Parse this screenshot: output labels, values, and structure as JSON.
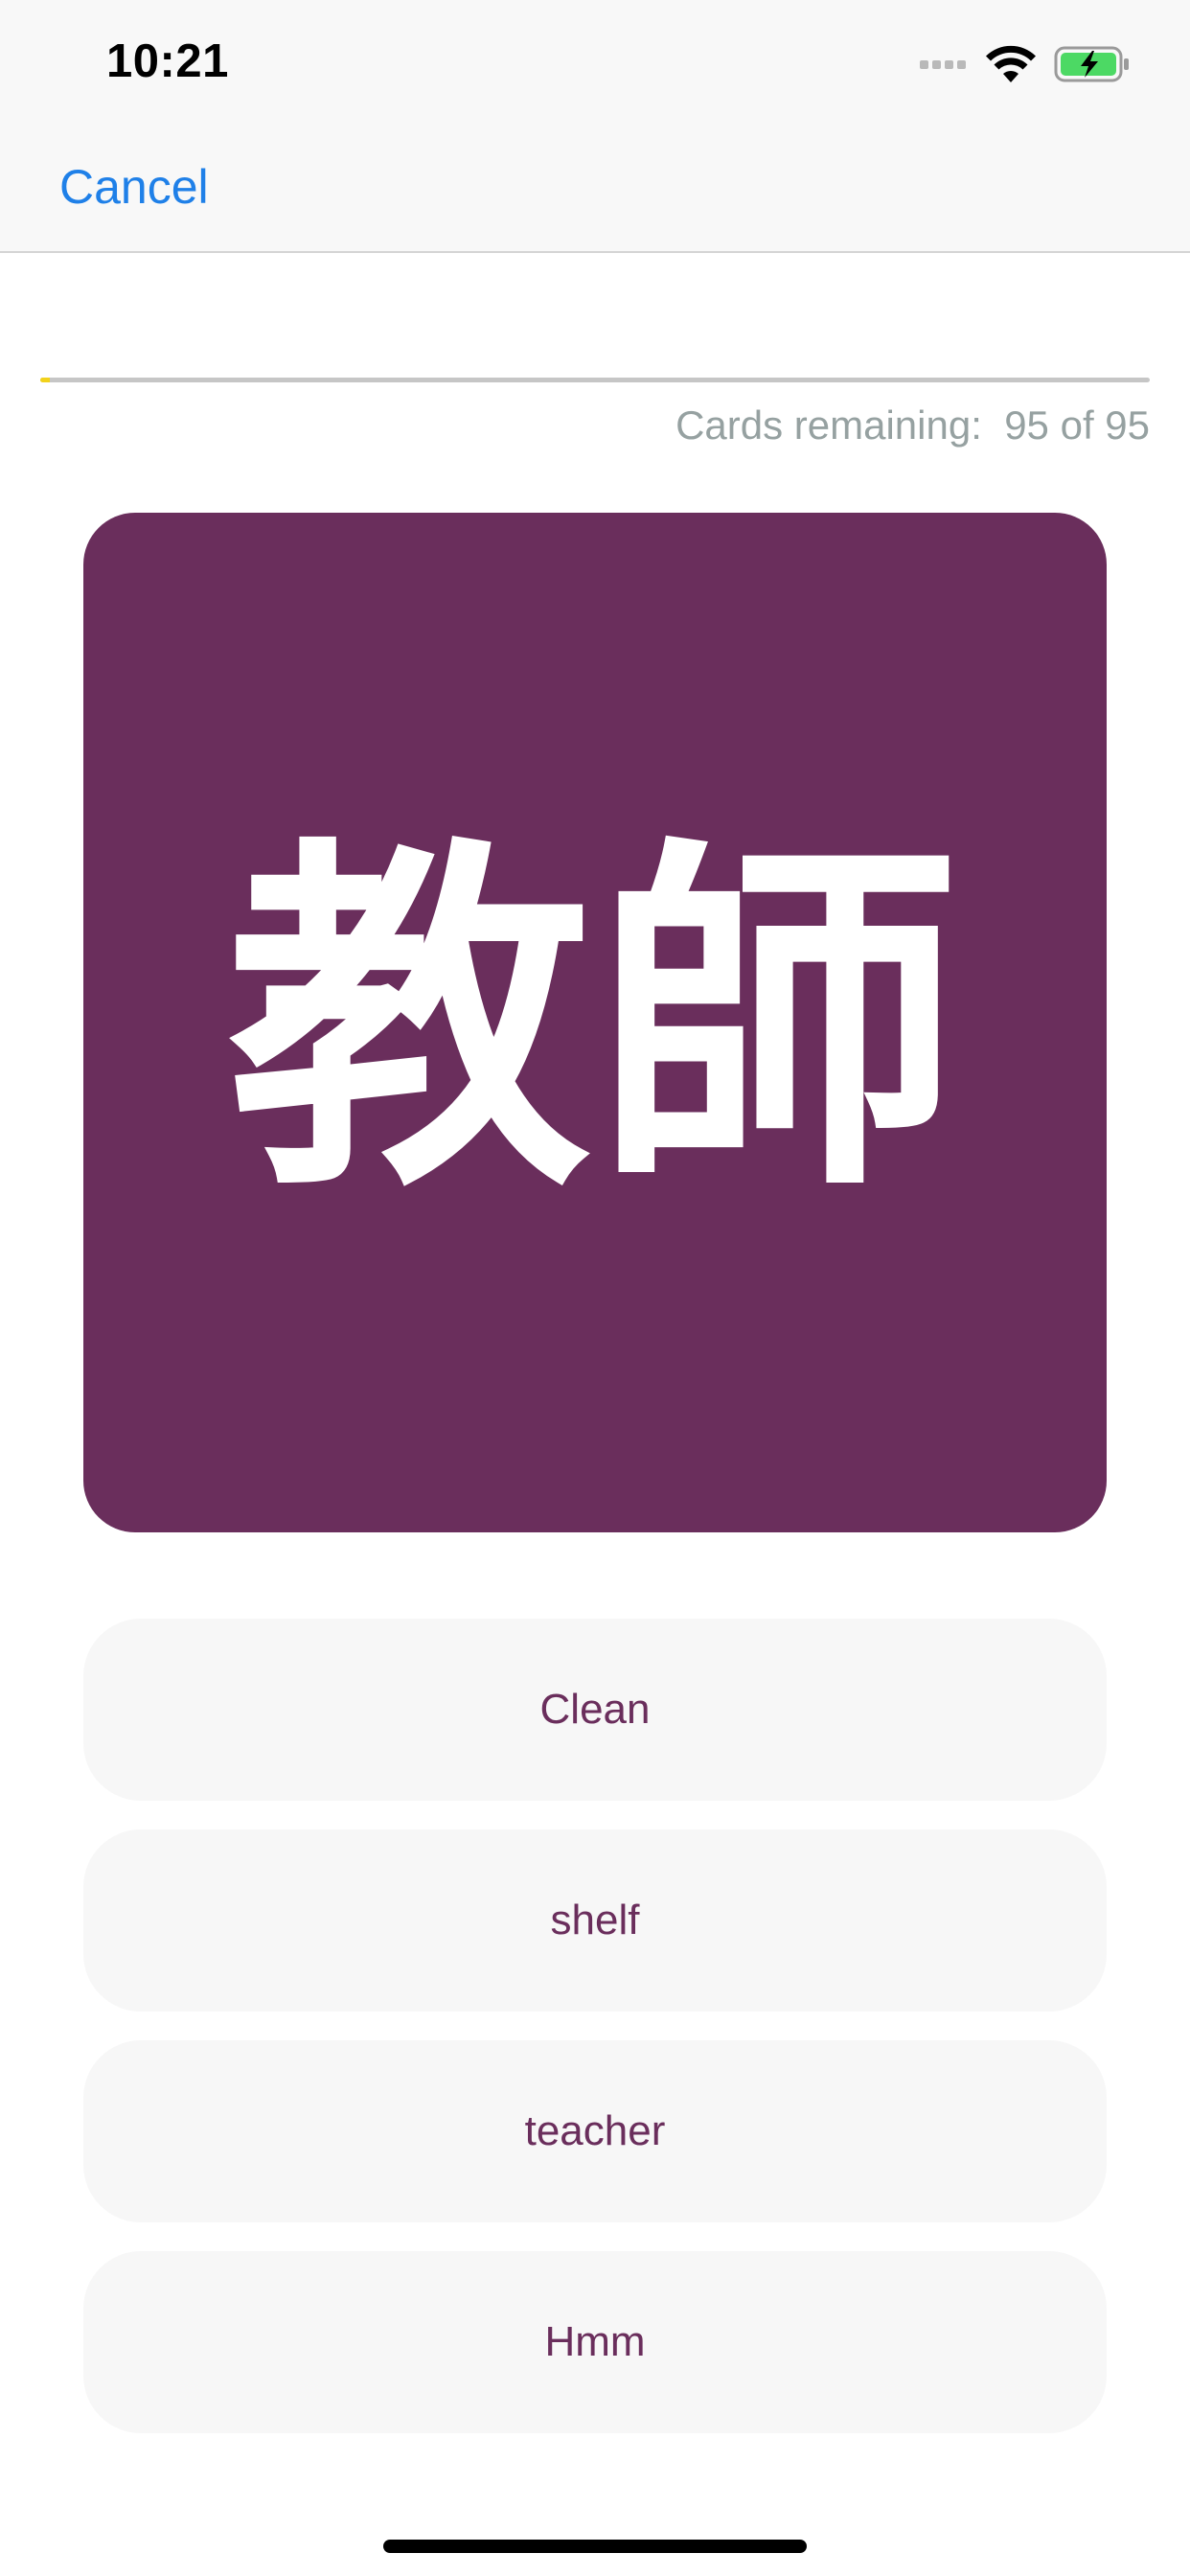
{
  "status_bar": {
    "time": "10:21"
  },
  "nav": {
    "cancel_label": "Cancel"
  },
  "progress": {
    "fraction_complete": 0.0,
    "label": "Cards remaining:  95 of 95"
  },
  "card": {
    "term": "教師",
    "background_color": "#6a2e5c"
  },
  "answers": [
    {
      "label": "Clean"
    },
    {
      "label": "shelf"
    },
    {
      "label": "teacher"
    },
    {
      "label": "Hmm"
    }
  ],
  "colors": {
    "accent_blue": "#1f80e8",
    "card_purple": "#6a2e5c",
    "progress_yellow": "#f2d21b",
    "muted_gray": "#96a1a1"
  },
  "icons": {
    "signal": "cellular-signal-icon",
    "wifi": "wifi-icon",
    "battery": "battery-charging-icon"
  }
}
